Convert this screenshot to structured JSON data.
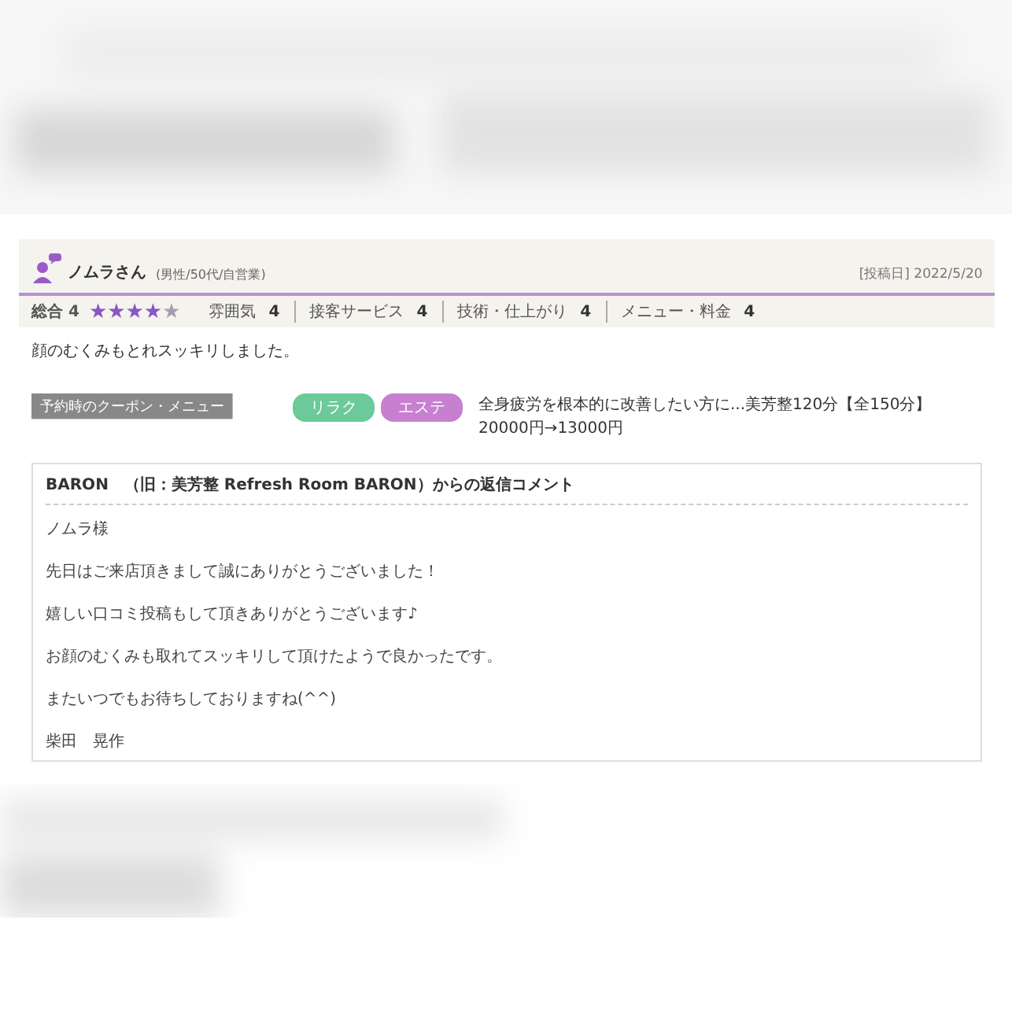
{
  "review": {
    "name": "ノムラさん",
    "profile": "(男性/50代/自営業)",
    "date": "[投稿日] 2022/5/20",
    "overall": {
      "label": "総合",
      "score": "4",
      "stars": 4
    },
    "ratings": [
      {
        "label": "雰囲気",
        "score": "4"
      },
      {
        "label": "接客サービス",
        "score": "4"
      },
      {
        "label": "技術・仕上がり",
        "score": "4"
      },
      {
        "label": "メニュー・料金",
        "score": "4"
      }
    ],
    "comment": "顔のむくみもとれスッキリしました。",
    "coupon": {
      "label": "予約時のクーポン・メニュー",
      "tags": [
        {
          "text": "リラク",
          "color": "#6cc99a"
        },
        {
          "text": "エステ",
          "color": "#c77fd0"
        }
      ],
      "text": "全身疲労を根本的に改善したい方に...美芳整120分【全150分】20000円→13000円"
    }
  },
  "reply": {
    "title": "BARON　（旧：美芳整 Refresh Room BARON）からの返信コメント",
    "lines": [
      "ノムラ様",
      "先日はご来店頂きまして誠にありがとうございました！",
      "嬉しい口コミ投稿もして頂きありがとうございます♪",
      "お顔のむくみも取れてスッキリして頂けたようで良かったです。",
      "またいつでもお待ちしておりますね(^^)",
      "柴田　晃作"
    ]
  }
}
